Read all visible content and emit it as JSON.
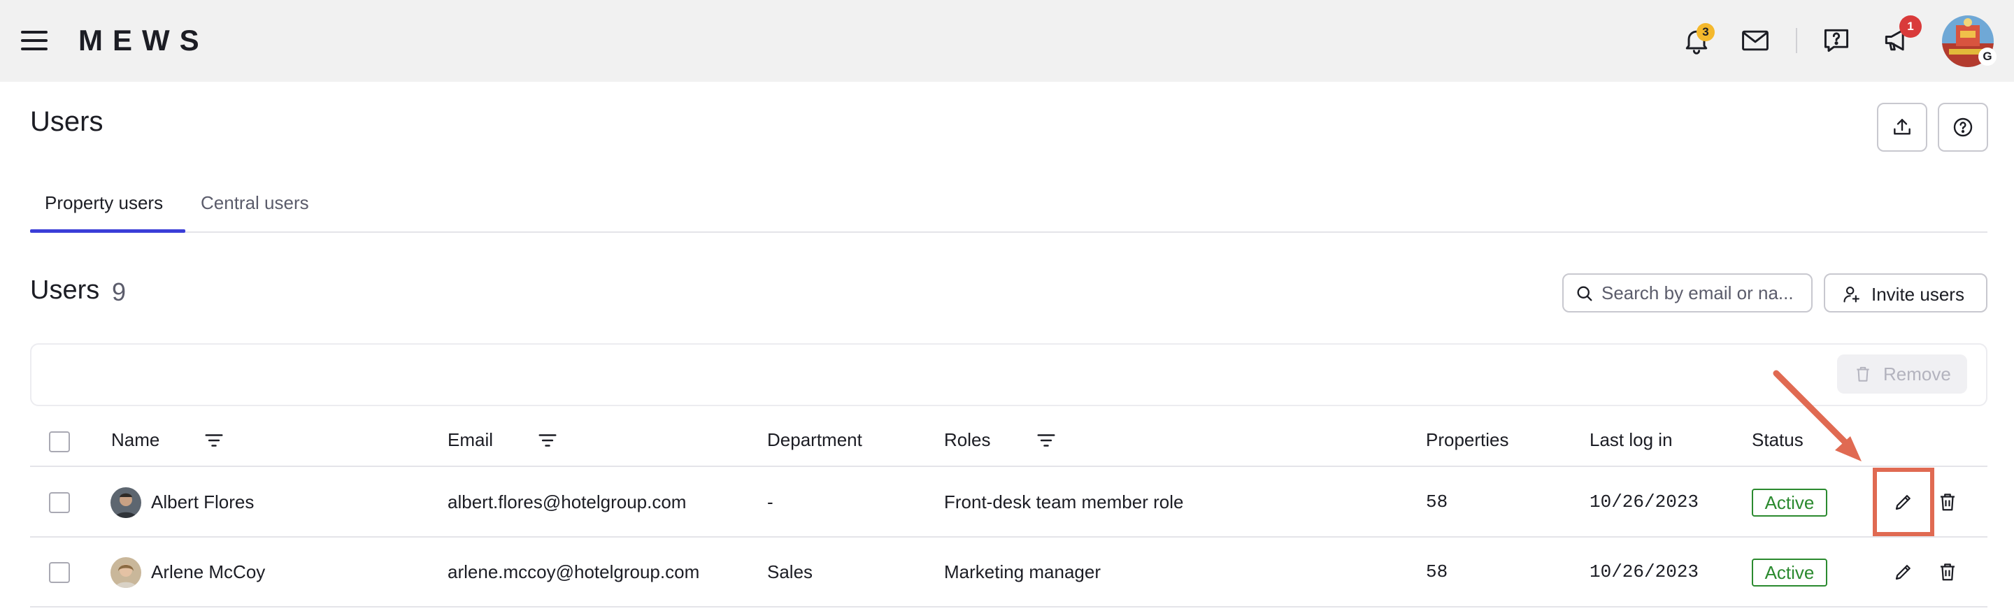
{
  "topbar": {
    "logo": "MEWS",
    "notifications_badge": "3",
    "announcements_badge": "1",
    "avatar_badge": "G",
    "colors": {
      "notification_badge": "#f4b82c",
      "announcement_badge": "#d93a3a"
    }
  },
  "page": {
    "title": "Users",
    "tabs": [
      {
        "label": "Property users",
        "active": true
      },
      {
        "label": "Central users",
        "active": false
      }
    ]
  },
  "section": {
    "title": "Users",
    "count": "9",
    "search_placeholder": "Search by email or na...",
    "invite_label": "Invite users",
    "remove_label": "Remove"
  },
  "table": {
    "columns": [
      "Name",
      "Email",
      "Department",
      "Roles",
      "Properties",
      "Last log in",
      "Status"
    ],
    "rows": [
      {
        "name": "Albert Flores",
        "email": "albert.flores@hotelgroup.com",
        "department": "-",
        "roles": "Front-desk team member role",
        "properties": "58",
        "last_log_in": "10/26/2023",
        "status": "Active"
      },
      {
        "name": "Arlene McCoy",
        "email": "arlene.mccoy@hotelgroup.com",
        "department": "Sales",
        "roles": "Marketing manager",
        "properties": "58",
        "last_log_in": "10/26/2023",
        "status": "Active"
      }
    ]
  },
  "colors": {
    "accent": "#3b3ed8",
    "status_active": "#2b8a2f",
    "annotation": "#e06a52"
  }
}
